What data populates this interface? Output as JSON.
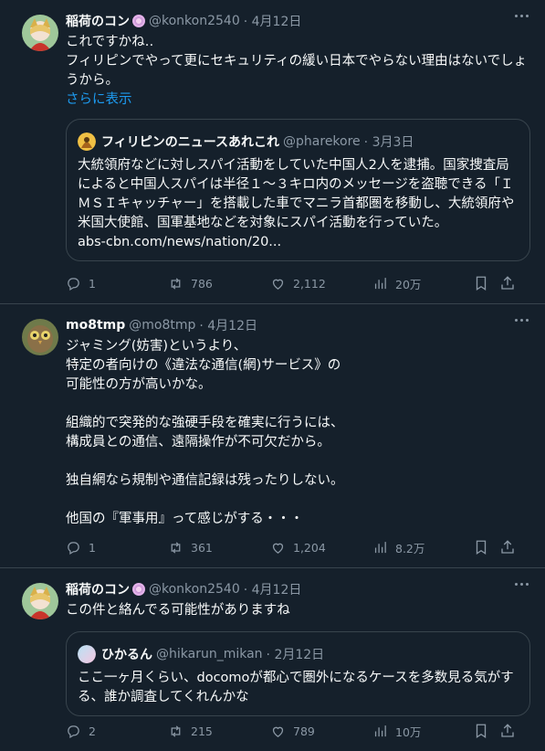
{
  "tweets": [
    {
      "name": "稲荷のコン",
      "handle": "@konkon2540",
      "date": "· 4月12日",
      "text": "これですかね‥\nフィリピンでやって更にセキュリティの緩い日本でやらない理由はないでしょうから。",
      "show_more": "さらに表示",
      "quote": {
        "name": "フィリピンのニュースあれこれ",
        "handle": "@pharekore",
        "date": "· 3月3日",
        "text": "大統領府などに対しスパイ活動をしていた中国人2人を逮捕。国家捜査局によると中国人スパイは半径１～３キロ内のメッセージを盗聴できる「ＩＭＳＩキャッチャー」を搭載した車でマニラ首都圏を移動し、大統領府や米国大使館、国軍基地などを対象にスパイ活動を行っていた。",
        "link": "abs-cbn.com/news/nation/20..."
      },
      "replies": "1",
      "retweets": "786",
      "likes": "2,112",
      "views": "20万"
    },
    {
      "name": "mo8tmp",
      "handle": "@mo8tmp",
      "date": "· 4月12日",
      "text": "ジャミング(妨害)というより、\n特定の者向けの《違法な通信(網)サービス》の\n可能性の方が高いかな。\n\n組織的で突発的な強硬手段を確実に行うには、\n構成員との通信、遠隔操作が不可欠だから。\n\n独自網なら規制や通信記録は残ったりしない。\n\n他国の『軍事用』って感じがする・・・",
      "replies": "1",
      "retweets": "361",
      "likes": "1,204",
      "views": "8.2万"
    },
    {
      "name": "稲荷のコン",
      "handle": "@konkon2540",
      "date": "· 4月12日",
      "text": "この件と絡んでる可能性がありますね",
      "quote": {
        "name": "ひかるん",
        "handle": "@hikarun_mikan",
        "date": "· 2月12日",
        "text": "ここ一ヶ月くらい、docomoが都心で圏外になるケースを多数見る気がする、誰か調査してくれんかな"
      },
      "replies": "2",
      "retweets": "215",
      "likes": "789",
      "views": "10万"
    }
  ]
}
